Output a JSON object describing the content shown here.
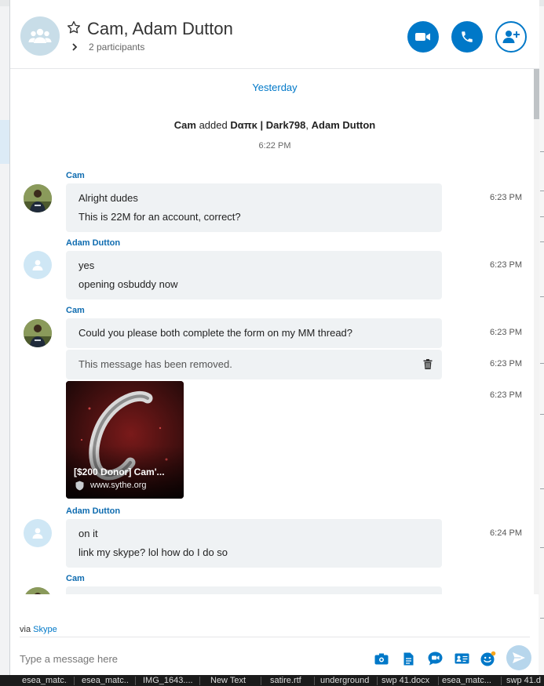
{
  "header": {
    "title": "Cam, Adam Dutton",
    "participants": "2 participants",
    "icons": {
      "group": "group-icon",
      "star": "star-icon",
      "video": "video-call-icon",
      "call": "phone-icon",
      "add": "add-person-icon"
    }
  },
  "colors": {
    "accent": "#0078c8",
    "sender": "#0f6cb0",
    "bubble": "#eff2f4",
    "avatar_default": "#cfe7f5",
    "send_disabled": "#b7d6ec"
  },
  "conversation": {
    "date_separator": "Yesterday",
    "system": {
      "actor": "Cam",
      "action": "added",
      "target1": "Dαπκ | Dark798",
      "separator": ",",
      "target2": "Adam Dutton",
      "time": "6:22 PM"
    },
    "groups": [
      {
        "sender": "Cam",
        "avatar": "photo",
        "messages": [
          {
            "lines": [
              "Alright dudes",
              "This is 22M for an account, correct?"
            ],
            "time": "6:23 PM"
          }
        ]
      },
      {
        "sender": "Adam Dutton",
        "avatar": "default",
        "messages": [
          {
            "lines": [
              "yes",
              "opening osbuddy now"
            ],
            "time": "6:23 PM"
          }
        ]
      },
      {
        "sender": "Cam",
        "avatar": "photo",
        "messages": [
          {
            "lines": [
              "Could you please both complete the form on my MM thread?"
            ],
            "time": "6:23 PM"
          },
          {
            "removed": "This message has been removed.",
            "time": "6:23 PM"
          },
          {
            "card": {
              "title": "[$200 Donor] Cam'...",
              "site": "www.sythe.org"
            },
            "time": "6:23 PM"
          }
        ]
      },
      {
        "sender": "Adam Dutton",
        "avatar": "default",
        "messages": [
          {
            "lines": [
              "on it",
              "link my skype? lol  how do I do so"
            ],
            "time": "6:24 PM"
          }
        ]
      },
      {
        "sender": "Cam",
        "avatar": "photo"
      }
    ]
  },
  "composer": {
    "via_prefix": "via",
    "via_link": "Skype",
    "placeholder": "Type a message here",
    "tools": [
      "media-icon",
      "file-icon",
      "video-message-icon",
      "contact-card-icon",
      "emoji-icon"
    ],
    "send": "send-icon"
  },
  "taskbar": {
    "items": [
      "esea_matc...",
      "esea_matc...",
      "IMG_1643....",
      "New Text",
      "satire.rtf",
      "underground",
      "swp 41.docx",
      "esea_matc...",
      "swp 41.d"
    ]
  }
}
